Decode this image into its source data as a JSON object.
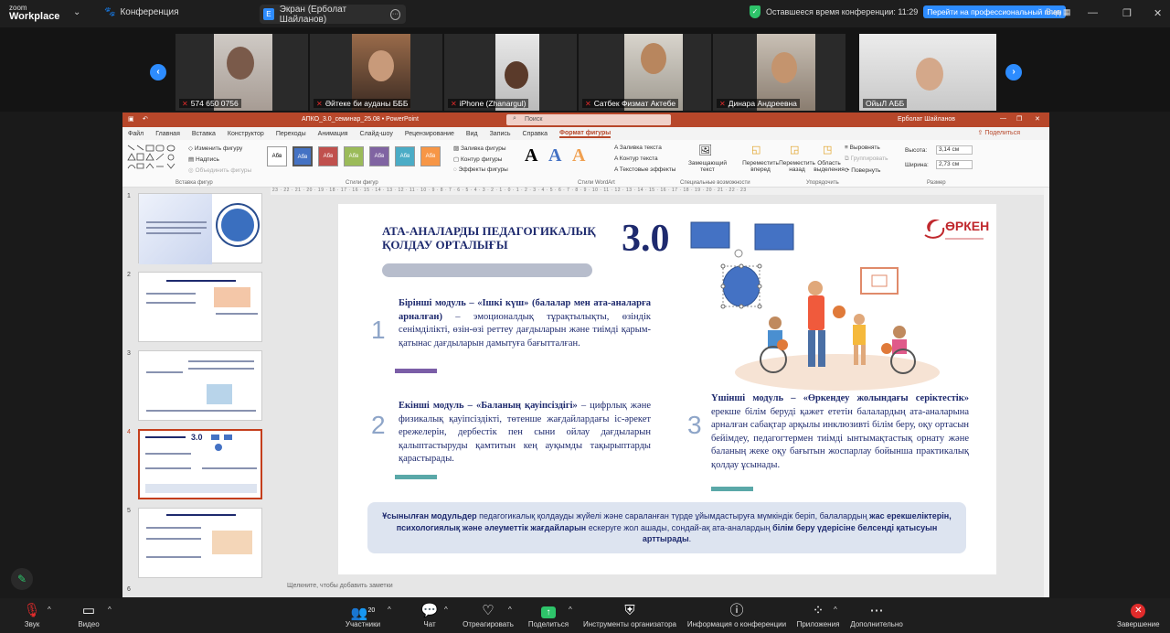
{
  "topbar": {
    "logo_line1": "zoom",
    "logo_line2": "Workplace",
    "conference_label": "Конференция",
    "screen_label": "Экран (Ерболат Шайланов)",
    "time_left": "Оставшееся время конференции: 11:29",
    "upgrade": "Перейти на профессиональный план",
    "view": "Вид"
  },
  "gallery": {
    "participants": [
      {
        "name": "574 650 0756"
      },
      {
        "name": "Әйтеке би ауданы БББ"
      },
      {
        "name": "iPhone (Zhanargul)"
      },
      {
        "name": "Сатбек Физмат Актебе"
      },
      {
        "name": "Динара Андреевна"
      },
      {
        "name": "ОйыЛ АББ"
      }
    ]
  },
  "ppt": {
    "filename": "АПКО_3.0_семинар_25.08 • PowerPoint",
    "search": "Поиск",
    "user": "Ерболат Шайланов",
    "menu": [
      "Файл",
      "Главная",
      "Вставка",
      "Конструктор",
      "Переходы",
      "Анимация",
      "Слайд-шоу",
      "Рецензирование",
      "Вид",
      "Запись",
      "Справка",
      "Формат фигуры"
    ],
    "share": "Поделиться",
    "ribbon": {
      "change_shape": "Изменить фигуру",
      "text_box": "Надпись",
      "merge_shapes": "Объединить фигуры",
      "insert_shapes": "Вставка фигур",
      "shape_styles": "Стили фигур",
      "fill": "Заливка фигуры",
      "outline": "Контур фигуры",
      "effects": "Эффекты фигуры",
      "text_fill": "Заливка текста",
      "text_outline": "Контур текста",
      "text_effects": "Текстовые эффекты",
      "wordart": "Стили WordArt",
      "alt_text": "Замещающий текст",
      "accessibility": "Специальные возможности",
      "bring_forward": "Переместить вперед",
      "send_backward": "Переместить назад",
      "selection_pane": "Область выделения",
      "align": "Выровнять",
      "group": "Группировать",
      "rotate": "Повернуть",
      "arrange": "Упорядочить",
      "height_label": "Высота:",
      "height_val": "3,14 см",
      "width_label": "Ширина:",
      "width_val": "2,73 см",
      "size": "Размер",
      "style_label": "Абв"
    },
    "notes_placeholder": "Щелкните, чтобы добавить заметки",
    "slide_numbers": [
      "1",
      "2",
      "3",
      "4",
      "5",
      "6"
    ]
  },
  "slide": {
    "title": "АТА-АНАЛАРДЫ ПЕДАГОГИКАЛЫҚ ҚОЛДАУ ОРТАЛЫҒЫ",
    "big_num": "3.0",
    "logo": "ӨРКЕН",
    "n1": "1",
    "n2": "2",
    "n3": "3",
    "mod1_bold": "Бірінші модуль – «Ішкі күш» (балалар мен ата-аналарға арналған)",
    "mod1_rest": " – эмоционалдық тұрақтылықты, өзіндік сенімділікті, өзін-өзі реттеу дағдыларын және тиімді қарым-қатынас дағдыларын дамытуға бағытталған.",
    "mod2_bold": "Екінші модуль – «Баланың қауіпсіздігі»",
    "mod2_rest": " – цифрлық және физикалық қауіпсіздікті, төтенше жағдайлардағы іс-әрекет ережелерін, дербестік пен сыни ойлау дағдыларын қалыптастыруды қамтитын кең ауқымды тақырыптарды қарастырады.",
    "mod3_bold": "Үшінші модуль – «Өркендеу жолындағы серіктестік»",
    "mod3_rest": " ерекше білім беруді қажет ететін балалардың ата-аналарына арналған сабақтар арқылы инклюзивті білім беру, оқу ортасын бейімдеу, педагогтермен тиімді ынтымақтастық орнату және баланың жеке оқу бағытын жоспарлау бойынша практикалық қолдау ұсынады.",
    "footer_a": "Ұсынылған модульдер",
    "footer_b": " педагогикалық қолдауды жүйелі және сараланған түрде ұйымдастыруға мүмкіндік беріп, балалардың ",
    "footer_c": "жас ерекшеліктерін, психологиялық және әлеуметтік жағдайларын",
    "footer_d": " ескеруге жол ашады, сондай-ақ ата-аналардың ",
    "footer_e": "білім беру үдерісіне белсенді қатысуын арттырады",
    "footer_f": "."
  },
  "bottombar": {
    "audio": "Звук",
    "video": "Видео",
    "participants": "Участники",
    "participants_count": "20",
    "chat": "Чат",
    "react": "Отреагировать",
    "share": "Поделиться",
    "host_tools": "Инструменты организатора",
    "info": "Информация о конференции",
    "apps": "Приложения",
    "more": "Дополнительно",
    "end": "Завершение"
  },
  "colors": {
    "zoom_blue": "#2d8cff",
    "ppt_red": "#b7472a",
    "slide_navy": "#1e2a6e",
    "end_red": "#e02b2b"
  }
}
